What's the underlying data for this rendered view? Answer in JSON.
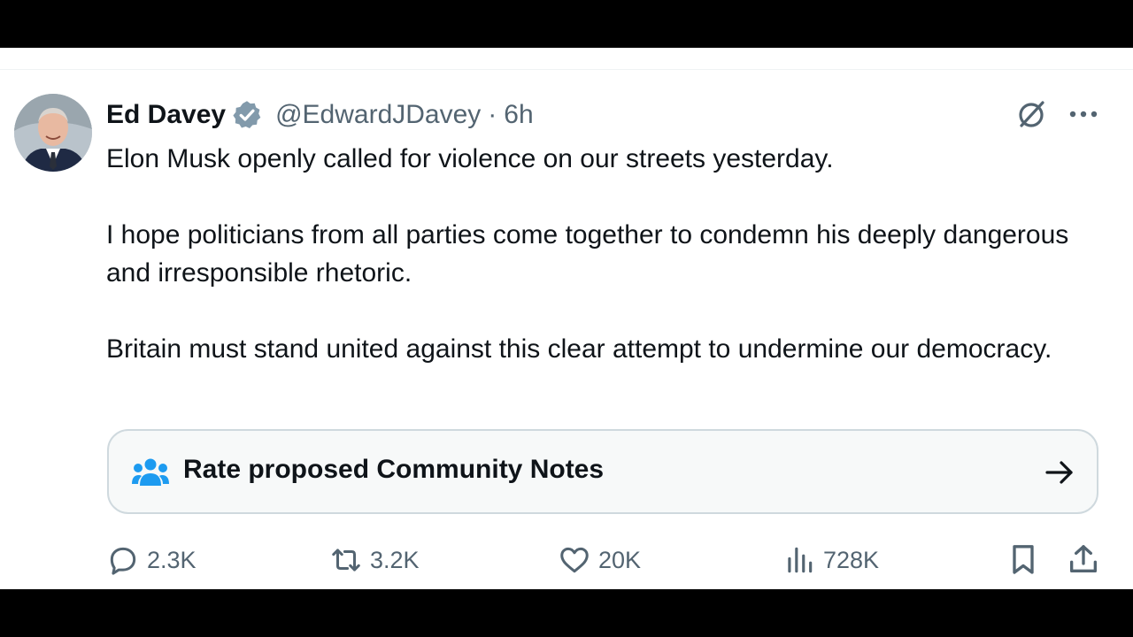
{
  "tweet": {
    "author_name": "Ed Davey",
    "handle": "@EdwardJDavey",
    "separator": "·",
    "time": "6h",
    "paragraphs": [
      "Elon Musk openly called for violence on our streets yesterday.",
      "I hope politicians from all parties come together to condemn his deeply dangerous and irresponsible rhetoric.",
      "Britain must stand united against this clear attempt to undermine our democracy."
    ]
  },
  "community_notes": {
    "label": "Rate proposed Community Notes"
  },
  "actions": {
    "replies": "2.3K",
    "reposts": "3.2K",
    "likes": "20K",
    "views": "728K"
  },
  "icons": {
    "verified": "verified-badge-icon",
    "grok": "grok-icon",
    "more": "more-icon",
    "notes": "community-notes-icon",
    "arrow": "arrow-right-icon",
    "reply": "reply-icon",
    "repost": "repost-icon",
    "like": "like-icon",
    "views": "views-icon",
    "bookmark": "bookmark-icon",
    "share": "share-icon"
  },
  "colors": {
    "text": "#0f1419",
    "secondary_text": "#536471",
    "verified_badge": "#829aab",
    "notes_icon": "#1d9bf0",
    "notes_border": "#cfd9de",
    "notes_bg": "#f7f9f9"
  }
}
